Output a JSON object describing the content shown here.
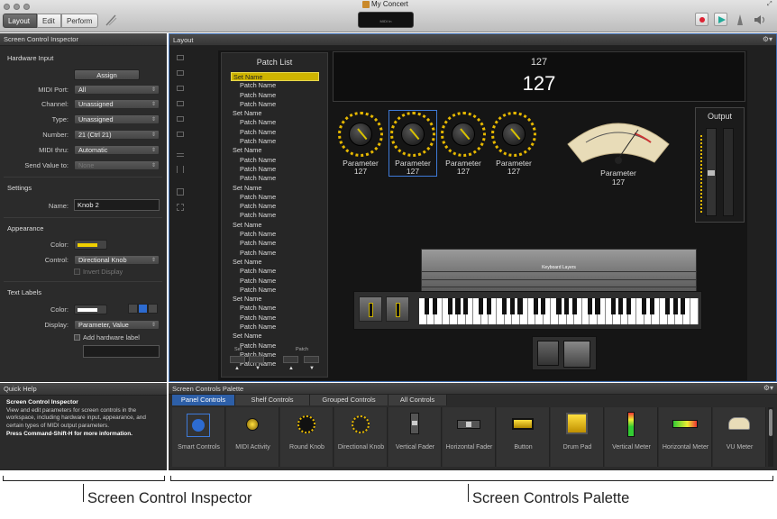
{
  "window": {
    "title": "My Concert",
    "midi_display": "MIDI In"
  },
  "toolbar": {
    "modes": [
      "Layout",
      "Edit",
      "Perform"
    ],
    "active_mode": "Layout"
  },
  "inspector": {
    "title": "Screen Control Inspector",
    "hardware_input": {
      "heading": "Hardware Input",
      "assign_label": "Assign",
      "rows": [
        {
          "label": "MIDI Port:",
          "value": "All"
        },
        {
          "label": "Channel:",
          "value": "Unassigned"
        },
        {
          "label": "Type:",
          "value": "Unassigned"
        },
        {
          "label": "Number:",
          "value": "21 (Ctrl 21)"
        },
        {
          "label": "MIDI thru:",
          "value": "Automatic"
        },
        {
          "label": "Send Value to:",
          "value": "None"
        }
      ]
    },
    "settings": {
      "heading": "Settings",
      "name_label": "Name:",
      "name_value": "Knob 2"
    },
    "appearance": {
      "heading": "Appearance",
      "color_label": "Color:",
      "control_label": "Control:",
      "control_value": "Directional Knob",
      "invert_label": "Invert Display",
      "color": "#f0d000"
    },
    "text_labels": {
      "heading": "Text Labels",
      "color_label": "Color:",
      "display_label": "Display:",
      "display_value": "Parameter, Value",
      "add_hw_label": "Add hardware label"
    }
  },
  "layout": {
    "title": "Layout",
    "patch_list": {
      "title": "Patch List",
      "rows": [
        {
          "kind": "set",
          "text": "Set Name"
        },
        {
          "kind": "patch",
          "text": "Patch Name"
        },
        {
          "kind": "patch",
          "text": "Patch Name"
        },
        {
          "kind": "patch",
          "text": "Patch Name"
        },
        {
          "kind": "set",
          "text": "Set Name"
        },
        {
          "kind": "patch",
          "text": "Patch Name"
        },
        {
          "kind": "patch",
          "text": "Patch Name"
        },
        {
          "kind": "patch",
          "text": "Patch Name"
        },
        {
          "kind": "set",
          "text": "Set Name"
        },
        {
          "kind": "patch",
          "text": "Patch Name"
        },
        {
          "kind": "patch",
          "text": "Patch Name"
        },
        {
          "kind": "patch",
          "text": "Patch Name"
        },
        {
          "kind": "set",
          "text": "Set Name"
        },
        {
          "kind": "patch",
          "text": "Patch Name"
        },
        {
          "kind": "patch",
          "text": "Patch Name"
        },
        {
          "kind": "patch",
          "text": "Patch Name"
        },
        {
          "kind": "set",
          "text": "Set Name"
        },
        {
          "kind": "patch",
          "text": "Patch Name"
        },
        {
          "kind": "patch",
          "text": "Patch Name"
        },
        {
          "kind": "patch",
          "text": "Patch Name"
        },
        {
          "kind": "set",
          "text": "Set Name"
        },
        {
          "kind": "patch",
          "text": "Patch Name"
        },
        {
          "kind": "patch",
          "text": "Patch Name"
        },
        {
          "kind": "patch",
          "text": "Patch Name"
        },
        {
          "kind": "set",
          "text": "Set Name"
        },
        {
          "kind": "patch",
          "text": "Patch Name"
        },
        {
          "kind": "patch",
          "text": "Patch Name"
        },
        {
          "kind": "patch",
          "text": "Patch Name"
        },
        {
          "kind": "set",
          "text": "Set Name"
        },
        {
          "kind": "patch",
          "text": "Patch Name"
        },
        {
          "kind": "patch",
          "text": "Patch Name"
        },
        {
          "kind": "patch",
          "text": "Patch Name"
        }
      ],
      "set_label": "Set",
      "patch_label": "Patch"
    },
    "display": {
      "small": "127",
      "big": "127"
    },
    "knobs": [
      {
        "name": "Parameter",
        "value": "127"
      },
      {
        "name": "Parameter",
        "value": "127"
      },
      {
        "name": "Parameter",
        "value": "127"
      },
      {
        "name": "Parameter",
        "value": "127"
      }
    ],
    "vu": {
      "name": "Parameter",
      "value": "127"
    },
    "output_label": "Output",
    "keyboard_layers_label": "Keyboard Layers"
  },
  "quick_help": {
    "title": "Quick Help",
    "heading": "Screen Control Inspector",
    "body": "View and edit parameters for screen controls in the workspace, including hardware input, appearance, and certain types of MIDI output parameters.",
    "hint": "Press Command-Shift-H for more information."
  },
  "palette": {
    "title": "Screen Controls Palette",
    "tabs": [
      "Panel Controls",
      "Shelf Controls",
      "Grouped Controls",
      "All Controls"
    ],
    "items": [
      "Smart Controls",
      "MIDI Activity",
      "Round Knob",
      "Directional Knob",
      "Vertical Fader",
      "Horizontal Fader",
      "Button",
      "Drum Pad",
      "Vertical Meter",
      "Horizontal Meter",
      "VU Meter"
    ]
  },
  "annotations": {
    "left": "Screen Control Inspector",
    "right": "Screen Controls Palette"
  }
}
